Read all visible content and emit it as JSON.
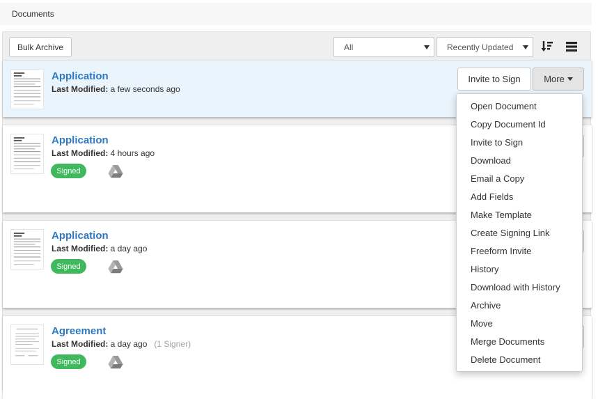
{
  "breadcrumb": {
    "title": "Documents"
  },
  "toolbar": {
    "bulk_archive_label": "Bulk Archive",
    "filter_selected": "All",
    "sort_selected": "Recently Updated",
    "sort_icon": "sort-order-icon",
    "view_icon": "list-view-icon"
  },
  "documents": [
    {
      "title": "Application",
      "modified_label": "Last Modified:",
      "modified_value": " a few seconds ago",
      "signers": "",
      "status": ""
    },
    {
      "title": "Application",
      "modified_label": "Last Modified:",
      "modified_value": " 4 hours ago",
      "signers": "",
      "status": "Signed"
    },
    {
      "title": "Application",
      "modified_label": "Last Modified:",
      "modified_value": " a day ago",
      "signers": "",
      "status": "Signed"
    },
    {
      "title": "Agreement",
      "modified_label": "Last Modified:",
      "modified_value": " a day ago",
      "signers": "(1 Signer)",
      "status": "Signed"
    }
  ],
  "row_actions": {
    "invite_label": "Invite to Sign",
    "more_label": "More"
  },
  "more_menu": [
    "Open Document",
    "Copy Document Id",
    "Invite to Sign",
    "Download",
    "Email a Copy",
    "Add Fields",
    "Make Template",
    "Create Signing Link",
    "Freeform Invite",
    "History",
    "Download with History",
    "Archive",
    "Move",
    "Merge Documents",
    "Delete Document"
  ],
  "colors": {
    "link": "#2e78be",
    "signed_badge": "#3fb85e",
    "active_row": "#eaf4fc",
    "drive_icon": "#9a9a9a"
  }
}
